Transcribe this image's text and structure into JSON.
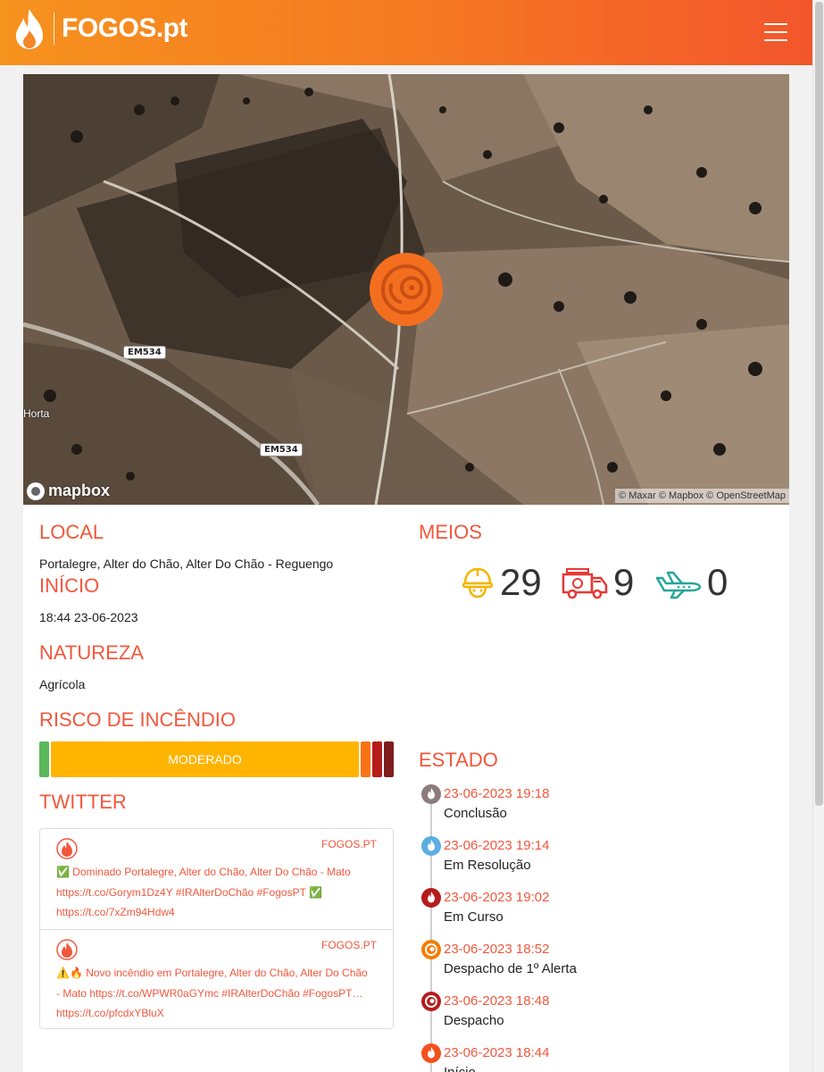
{
  "header": {
    "logo_text": "FOGOS.pt",
    "menu_icon": "hamburger-menu-icon"
  },
  "map": {
    "road_labels": [
      "EM534",
      "EM534"
    ],
    "place_label": "Horta",
    "mapbox_logo": "mapbox",
    "attribution": "© Maxar © Mapbox © OpenStreetMap"
  },
  "local": {
    "title": "LOCAL",
    "value": "Portalegre, Alter do Chão, Alter Do Chão - Reguengo"
  },
  "inicio": {
    "title": "INÍCIO",
    "value": "18:44 23-06-2023"
  },
  "natureza": {
    "title": "NATUREZA",
    "value": "Agrícola"
  },
  "risco": {
    "title": "RISCO DE INCÊNDIO",
    "current_label": "MODERADO",
    "colors": {
      "low": "#5cb85c",
      "moderate": "#ffb400",
      "high": "#f97316",
      "very_high": "#b71c1c",
      "max": "#7f1d1d"
    }
  },
  "meios": {
    "title": "MEIOS",
    "operacionais": "29",
    "terrestres": "9",
    "aereos": "0"
  },
  "twitter": {
    "title": "TWITTER",
    "tweets": [
      {
        "user": "FOGOS.PT",
        "text": "✅ Dominado Portalegre, Alter do Chão, Alter Do Chão - Mato https://t.co/Gorym1Dz4Y #IRAlterDoChão #FogosPT ✅ https://t.co/7xZm94Hdw4"
      },
      {
        "user": "FOGOS.PT",
        "text": "⚠️🔥 Novo incêndio em Portalegre, Alter do Chão, Alter Do Chão - Mato https://t.co/WPWR0aGYmc #IRAlterDoChão #FogosPT… https://t.co/pfcdxYBluX"
      }
    ]
  },
  "estado": {
    "title": "ESTADO",
    "events": [
      {
        "date": "23-06-2023 19:18",
        "label": "Conclusão",
        "color": "#8d7b7b"
      },
      {
        "date": "23-06-2023 19:14",
        "label": "Em Resolução",
        "color": "#5dade2"
      },
      {
        "date": "23-06-2023 19:02",
        "label": "Em Curso",
        "color": "#b71c1c"
      },
      {
        "date": "23-06-2023 18:52",
        "label": "Despacho de 1º Alerta",
        "color": "#f57c00"
      },
      {
        "date": "23-06-2023 18:48",
        "label": "Despacho",
        "color": "#b71c1c"
      },
      {
        "date": "23-06-2023 18:44",
        "label": "Início",
        "color": "#f4511e"
      }
    ]
  }
}
